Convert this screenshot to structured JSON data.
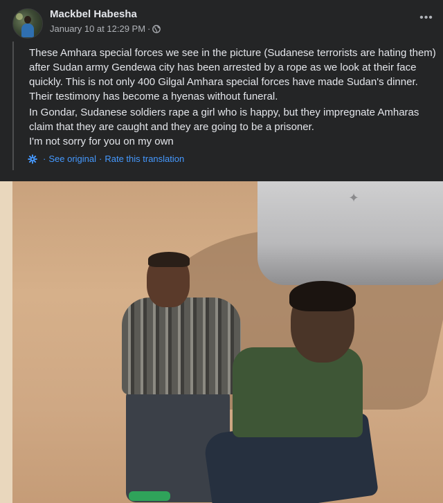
{
  "post": {
    "author": "Mackbel Habesha",
    "timestamp": "January 10 at 12:29 PM",
    "separator": "·",
    "privacy_icon": "globe-icon",
    "more_icon": "more-options-icon"
  },
  "body": {
    "paragraph_1": "These Amhara special forces we see in the picture (Sudanese terrorists are hating them) after Sudan army Gendewa city has been arrested by a rope as we look at their face quickly. This is not only 400 Gilgal Amhara special forces have made Sudan's dinner. Their testimony has become a hyenas without funeral.",
    "paragraph_2": "In Gondar, Sudanese soldiers rape a girl who is happy, but they impregnate Amharas claim that they are caught and they are going to be a prisoner.\nI'm not sorry for you on my own"
  },
  "translation": {
    "icon": "gear-icon",
    "prefix": "·",
    "see_original": "See original",
    "separator": "·",
    "rate": "Rate this translation"
  },
  "colors": {
    "background": "#242526",
    "text": "#e4e6eb",
    "secondary_text": "#b0b3b8",
    "link": "#4599ff"
  }
}
